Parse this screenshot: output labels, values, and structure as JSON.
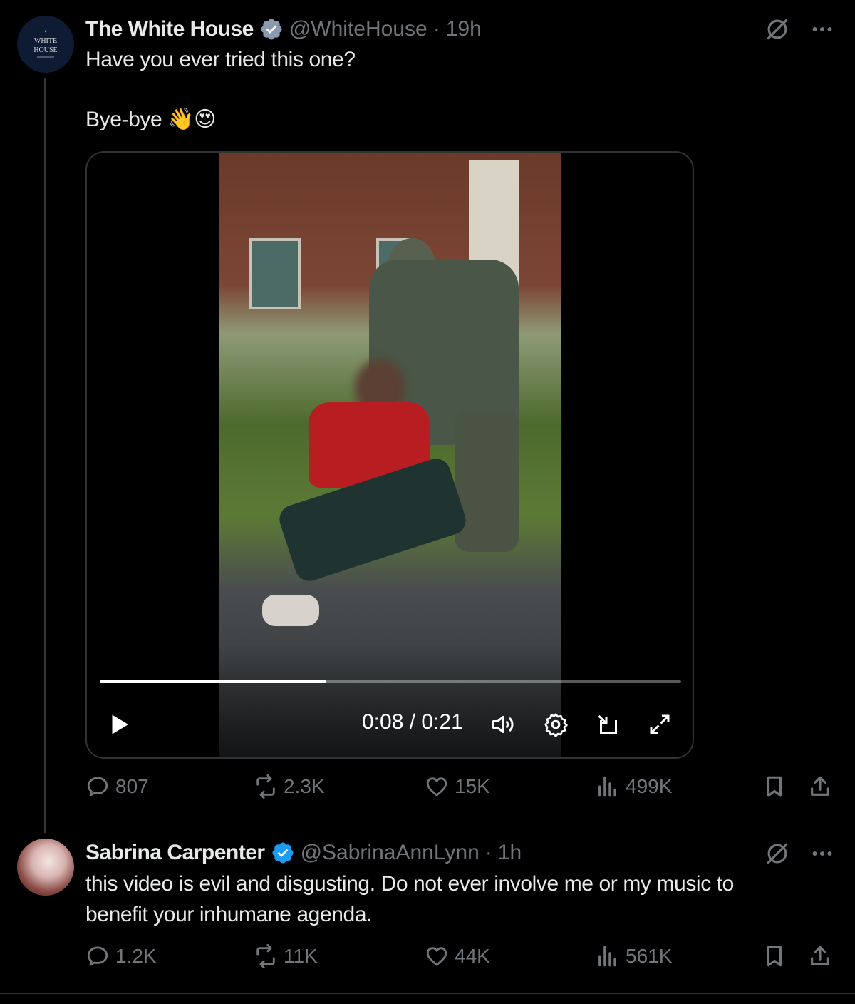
{
  "tweet1": {
    "name": "The White House",
    "handle": "@WhiteHouse",
    "time": "19h",
    "line1": "Have you ever tried this one?",
    "line2": "Bye-bye 👋😍",
    "avatar_text": "WHITE HOUSE",
    "video": {
      "time_display": "0:08 / 0:21",
      "progress": 0.39
    },
    "stats": {
      "replies": "807",
      "reposts": "2.3K",
      "likes": "15K",
      "views": "499K"
    }
  },
  "tweet2": {
    "name": "Sabrina Carpenter",
    "handle": "@SabrinaAnnLynn",
    "time": "1h",
    "line1": "this video is evil and disgusting. Do not ever involve me or my music to",
    "line2": "benefit your inhumane agenda.",
    "stats": {
      "replies": "1.2K",
      "reposts": "11K",
      "likes": "44K",
      "views": "561K"
    }
  },
  "colors": {
    "background": "#000000",
    "text": "#e7e9ea",
    "muted": "#71767b",
    "verified": "#1d9bf0",
    "divider": "#2f3336"
  },
  "icons": [
    "verified-icon",
    "grok-icon",
    "more-icon",
    "play-icon",
    "volume-icon",
    "settings-icon",
    "pip-icon",
    "fullscreen-icon",
    "reply-icon",
    "repost-icon",
    "like-icon",
    "views-icon",
    "bookmark-icon",
    "share-icon"
  ]
}
